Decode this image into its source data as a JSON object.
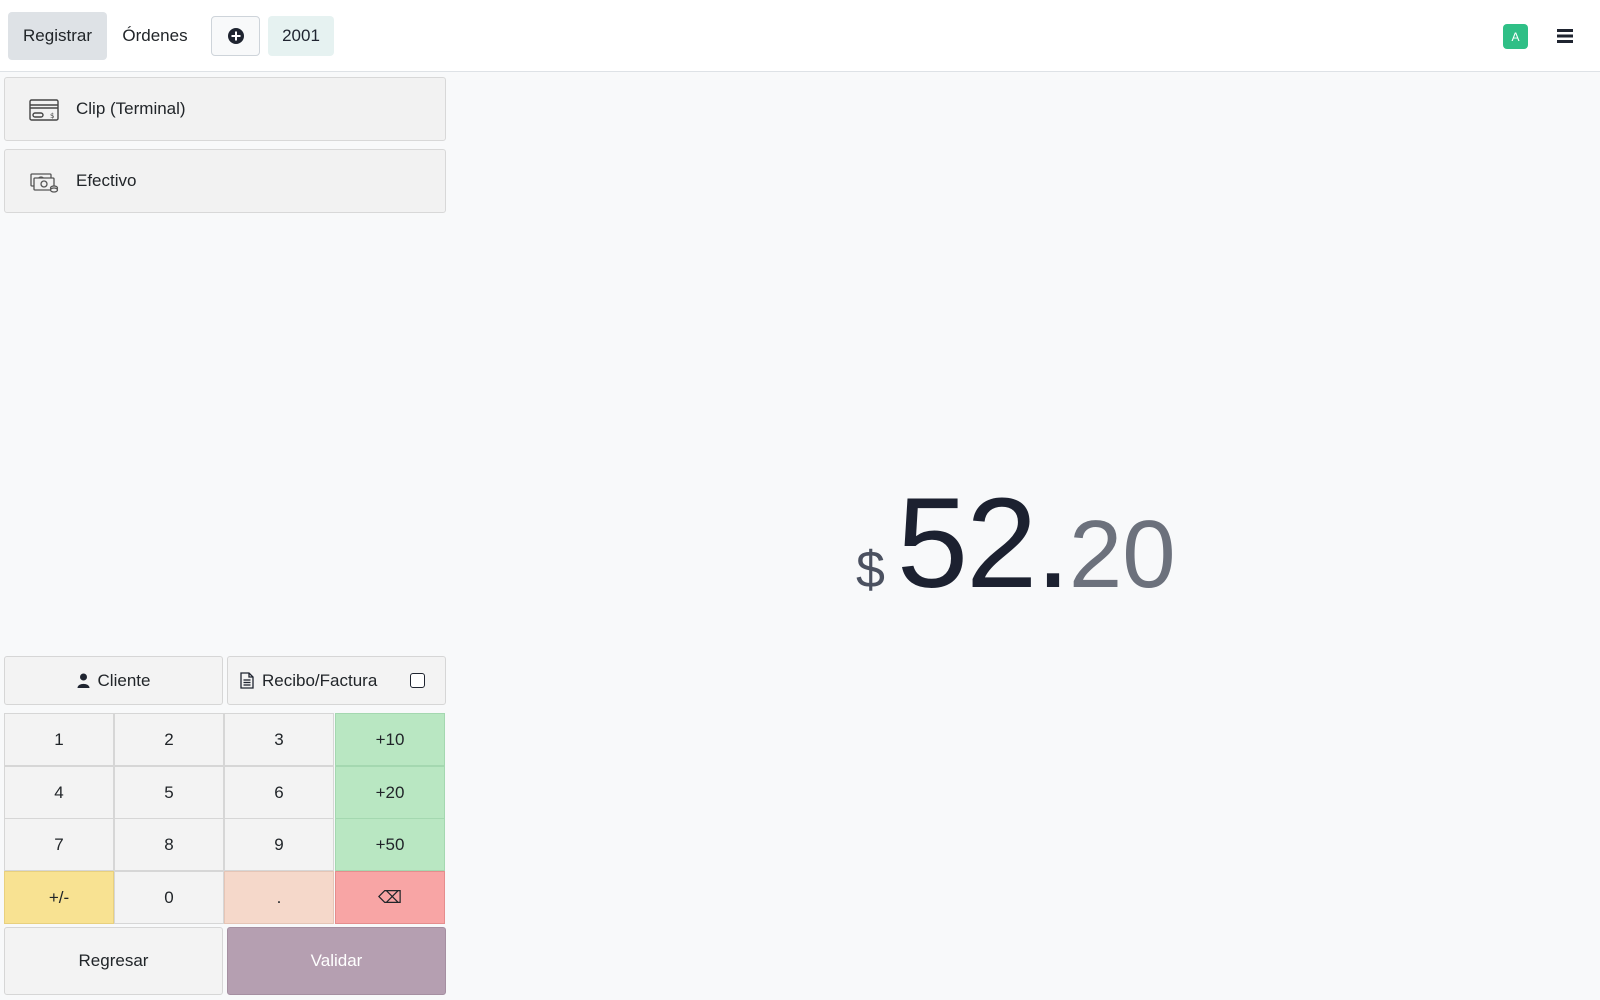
{
  "header": {
    "tabs": [
      {
        "label": "Registrar",
        "active": true
      },
      {
        "label": "Órdenes",
        "active": false
      }
    ],
    "new_order_icon": "plus-circle-icon",
    "order_number": "2001",
    "avatar_letter": "A",
    "avatar_color": "#2fbf86",
    "menu_icon": "hamburger-icon"
  },
  "payment_methods": [
    {
      "label": "Clip (Terminal)",
      "icon": "card-terminal-icon"
    },
    {
      "label": "Efectivo",
      "icon": "cash-icon"
    }
  ],
  "amount": {
    "currency": "$",
    "integer": "52.",
    "decimals": "20"
  },
  "actions": {
    "customer_label": "Cliente",
    "invoice_label": "Recibo/Factura",
    "invoice_checked": false,
    "back_label": "Regresar",
    "validate_label": "Validar",
    "validate_color": "#b59fb1"
  },
  "numpad": {
    "keys": [
      "1",
      "2",
      "3",
      "+10",
      "4",
      "5",
      "6",
      "+20",
      "7",
      "8",
      "9",
      "+50",
      "+/-",
      "0",
      ".",
      "⌫"
    ],
    "colors": {
      "quick_add": "#b9e7c2",
      "sign": "#f8e292",
      "decimal": "#f5d8ca",
      "backspace": "#f8a5a5"
    }
  }
}
